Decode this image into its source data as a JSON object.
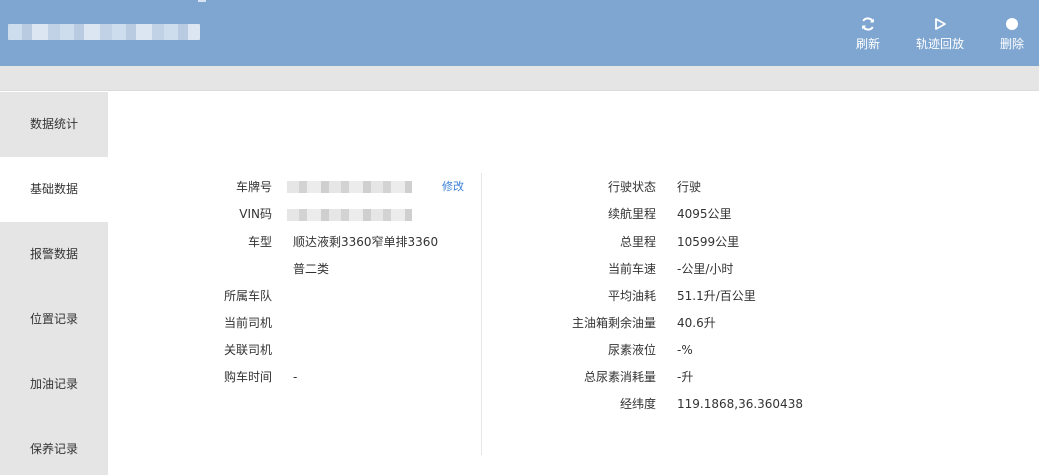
{
  "toolbar": {
    "refresh_label": "刷新",
    "playback_label": "轨迹回放",
    "delete_label": "删除"
  },
  "sidebar": {
    "items": [
      {
        "label": "数据统计"
      },
      {
        "label": "基础数据"
      },
      {
        "label": "报警数据"
      },
      {
        "label": "位置记录"
      },
      {
        "label": "加油记录"
      },
      {
        "label": "保养记录"
      }
    ],
    "active_index": 1
  },
  "left_panel": {
    "plate_label": "车牌号",
    "edit_label": "修改",
    "vin_label": "VIN码",
    "model_label": "车型",
    "model_value_line1": "顺达液剩3360窄单排3360",
    "model_value_line2": "普二类",
    "fleet_label": "所属车队",
    "driver_label": "当前司机",
    "linked_driver_label": "关联司机",
    "purchase_label": "购车时间",
    "purchase_value": "-"
  },
  "right_panel": {
    "rows": [
      {
        "label": "行驶状态",
        "value": "行驶"
      },
      {
        "label": "续航里程",
        "value": "4095公里"
      },
      {
        "label": "总里程",
        "value": "10599公里"
      },
      {
        "label": "当前车速",
        "value": "-公里/小时"
      },
      {
        "label": "平均油耗",
        "value": "51.1升/百公里"
      },
      {
        "label": "主油箱剩余油量",
        "value": "40.6升"
      },
      {
        "label": "尿素液位",
        "value": "-%"
      },
      {
        "label": "总尿素消耗量",
        "value": "-升"
      },
      {
        "label": "经纬度",
        "value": "119.1868,36.360438"
      }
    ]
  },
  "colors": {
    "header": "#7fa6d1",
    "sidebar": "#e5e5e5",
    "link": "#3b7fd4"
  }
}
